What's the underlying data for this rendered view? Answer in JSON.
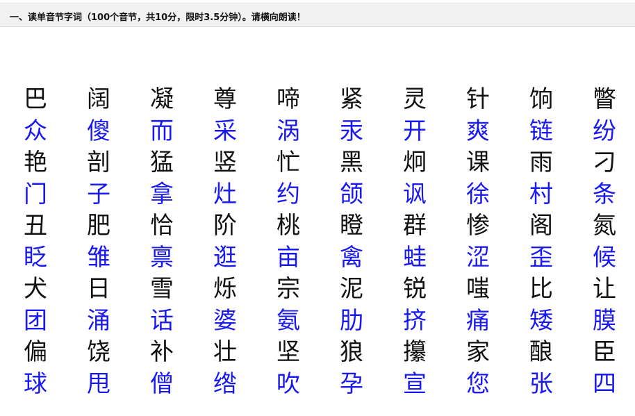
{
  "instruction": "一、读单音节字词（100个音节，共10分，限时3.5分钟）。请横向朗读！",
  "rows": [
    {
      "color": "black",
      "chars": [
        "巴",
        "阔",
        "凝",
        "尊",
        "啼",
        "紧",
        "灵",
        "针",
        "饷",
        "瞥"
      ]
    },
    {
      "color": "blue",
      "chars": [
        "众",
        "傻",
        "而",
        "采",
        "涡",
        "汞",
        "开",
        "爽",
        "链",
        "纷"
      ]
    },
    {
      "color": "black",
      "chars": [
        "艳",
        "剖",
        "猛",
        "竖",
        "忙",
        "黑",
        "炯",
        "课",
        "雨",
        "刁"
      ]
    },
    {
      "color": "blue",
      "chars": [
        "门",
        "子",
        "拿",
        "灶",
        "约",
        "颌",
        "讽",
        "徐",
        "村",
        "条"
      ]
    },
    {
      "color": "black",
      "chars": [
        "丑",
        "肥",
        "恰",
        "阶",
        "桃",
        "瞪",
        "群",
        "惨",
        "阁",
        "氮"
      ]
    },
    {
      "color": "blue",
      "chars": [
        "眨",
        "雏",
        "禀",
        "逛",
        "亩",
        "禽",
        "蛙",
        "涩",
        "歪",
        "候"
      ]
    },
    {
      "color": "black",
      "chars": [
        "犬",
        "日",
        "雪",
        "烁",
        "宗",
        "泥",
        "锐",
        "嗤",
        "比",
        "让"
      ]
    },
    {
      "color": "blue",
      "chars": [
        "团",
        "涌",
        "话",
        "婆",
        "氨",
        "肋",
        "挤",
        "痛",
        "矮",
        "膜"
      ]
    },
    {
      "color": "black",
      "chars": [
        "偏",
        "饶",
        "补",
        "壮",
        "坚",
        "狼",
        "攥",
        "家",
        "酿",
        "臣"
      ]
    },
    {
      "color": "blue",
      "chars": [
        "球",
        "甩",
        "僧",
        "绺",
        "吹",
        "孕",
        "宣",
        "您",
        "张",
        "四"
      ]
    }
  ]
}
